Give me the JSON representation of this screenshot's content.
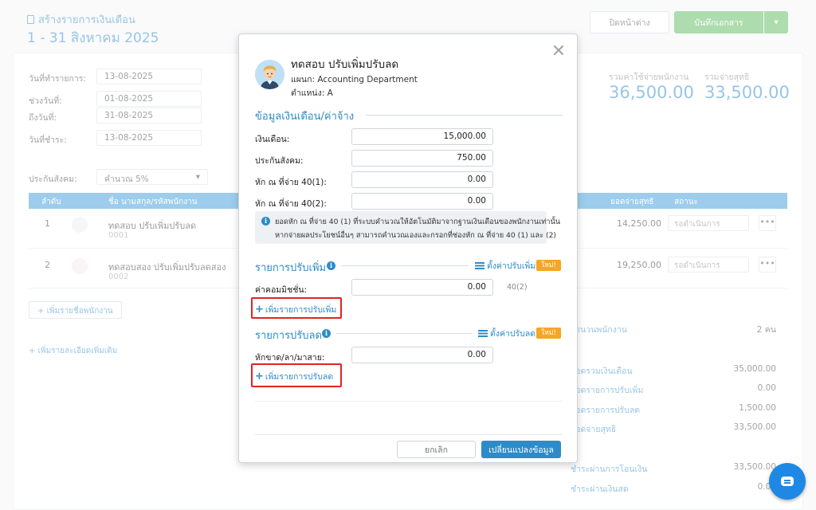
{
  "background": {
    "page_title": "สร้างรายการเงินเดือน",
    "period": "1 - 31 สิงหาคม 2025",
    "close_button": "ปิดหน้าต่าง",
    "save_document_button": "บันทึกเอกสาร",
    "fields": [
      {
        "label": "วันที่ทำรายการ:",
        "value": "13-08-2025"
      },
      {
        "label": "ช่วงวันที่:",
        "value": "01-08-2025"
      },
      {
        "label": "ถึงวันที่:",
        "value": "31-08-2025"
      },
      {
        "label": "วันที่ชำระ:",
        "value": "13-08-2025"
      }
    ],
    "social_security": {
      "label": "ประกันสังคม:",
      "value": "คำนวณ 5%"
    },
    "summary": [
      {
        "label": "รวมค่าใช้จ่ายพนักงาน",
        "value": "36,500.00"
      },
      {
        "label": "รวมจ่ายสุทธิ",
        "value": "33,500.00"
      }
    ],
    "table": {
      "headers": [
        "ลำดับ",
        "ชื่อ นามสกุล/รหัสพนักงาน",
        "ยอดจ่ายสุทธิ",
        "สถานะ"
      ],
      "rows": [
        {
          "no": "1",
          "name": "ทดสอบ ปรับเพิ่มปรับลด",
          "code": "0001",
          "net": "14,250.00",
          "status": "รอดำเนินการ"
        },
        {
          "no": "2",
          "name": "ทดสอบสอง ปรับเพิ่มปรับลดสอง",
          "code": "0002",
          "net": "19,250.00",
          "status": "รอดำเนินการ"
        }
      ]
    },
    "add_employee": "เพิ่มรายชื่อพนักงาน",
    "add_more_details": "เพิ่มรายละเอียดเพิ่มเติม",
    "right_summary": [
      {
        "label": "จำนวนพนักงาน",
        "value": "2 คน"
      },
      {
        "label": "ยอดรวมเงินเดือน",
        "value": "35,000.00"
      },
      {
        "label": "ยอดรายการปรับเพิ่ม",
        "value": "0.00"
      },
      {
        "label": "ยอดรายการปรับลด",
        "value": "1,500.00"
      },
      {
        "label": "ยอดจ่ายสุทธิ",
        "value": "33,500.00"
      },
      {
        "label": "ชำระผ่านการโอนเงิน",
        "value": "33,500.00"
      },
      {
        "label": "ชำระผ่านเงินสด",
        "value": "0.00"
      }
    ]
  },
  "modal": {
    "employee": {
      "name": "ทดสอบ ปรับเพิ่มปรับลด",
      "department": "แผนก: Accounting Department",
      "position": "ตำแหน่ง: A"
    },
    "salary_section": {
      "title": "ข้อมูลเงินเดือน/ค่าจ้าง",
      "fields": [
        {
          "label": "เงินเดือน:",
          "value": "15,000.00"
        },
        {
          "label": "ประกันสังคม:",
          "value": "750.00"
        },
        {
          "label": "หัก ณ ที่จ่าย 40(1):",
          "value": "0.00"
        },
        {
          "label": "หัก ณ ที่จ่าย 40(2):",
          "value": "0.00"
        }
      ],
      "note_line1": "ยอดหัก ณ ที่จ่าย 40 (1) ที่ระบบคำนวณให้อัตโนมัติมาจากฐานเงินเดือนของพนักงานเท่านั้น",
      "note_line2": "หากจ่ายผลประโยชน์อื่นๆ สามารถคำนวณเองและกรอกที่ช่องหัก ณ ที่จ่าย 40 (1) และ (2)"
    },
    "increase_section": {
      "title": "รายการปรับเพิ่ม",
      "settings_link": "ตั้งค่าปรับเพิ่ม",
      "badge": "ใหม่!",
      "item_label": "ค่าคอมมิชชั่น:",
      "item_value": "0.00",
      "item_tax": "40(2)",
      "add_link": "เพิ่มรายการปรับเพิ่ม"
    },
    "decrease_section": {
      "title": "รายการปรับลด",
      "settings_link": "ตั้งค่าปรับลด",
      "badge": "ใหม่!",
      "item_label": "หักขาด/ลา/มาสาย:",
      "item_value": "0.00",
      "add_link": "เพิ่มรายการปรับลด"
    },
    "cancel_button": "ยกเลิก",
    "save_button": "เปลี่ยนแปลงข้อมูล"
  },
  "colors": {
    "accent": "#2e8bc8",
    "highlight": "#e02424",
    "badge": "#f5a623"
  }
}
